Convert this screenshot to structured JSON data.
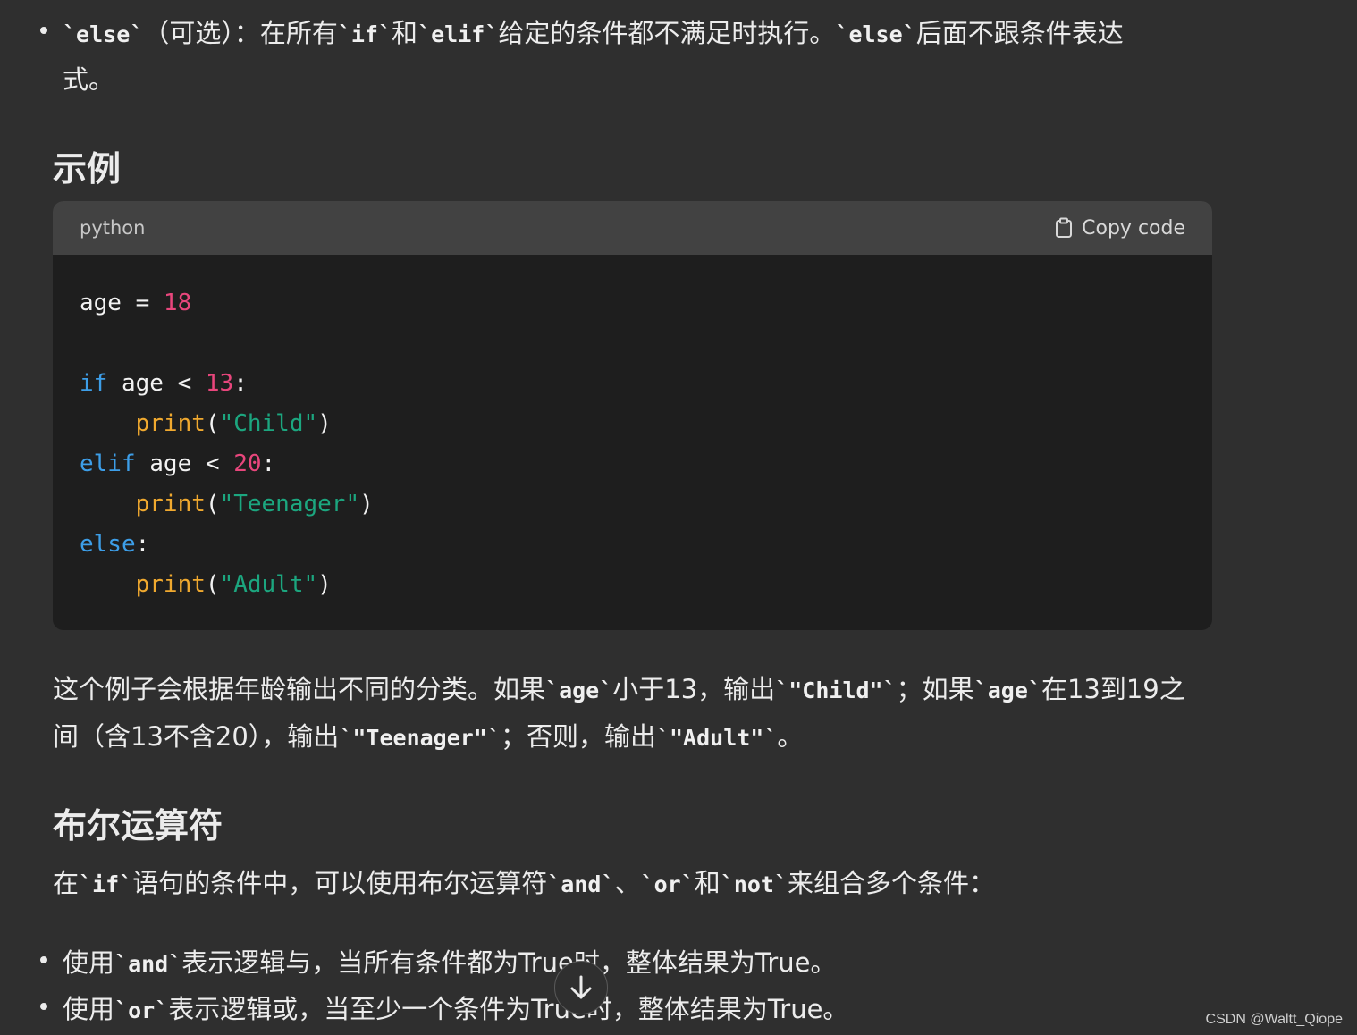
{
  "top_bullet": {
    "code1": "`else`",
    "text1": "（可选）：在所有",
    "code2": "`if`",
    "text2": "和",
    "code3": "`elif`",
    "text3": "给定的条件都不满足时执行。",
    "code4": "`else`",
    "text4": "后面不跟条件表达",
    "text5": "式。"
  },
  "example_heading": "示例",
  "code_block": {
    "language": "python",
    "copy_label": "Copy code",
    "lines": {
      "l1_a": "age = ",
      "l1_b": "18",
      "l3_a": "if",
      "l3_b": " age < ",
      "l3_c": "13",
      "l3_d": ":",
      "l4_a": "    ",
      "l4_b": "print",
      "l4_c": "(",
      "l4_d": "\"Child\"",
      "l4_e": ")",
      "l5_a": "elif",
      "l5_b": " age < ",
      "l5_c": "20",
      "l5_d": ":",
      "l6_a": "    ",
      "l6_b": "print",
      "l6_c": "(",
      "l6_d": "\"Teenager\"",
      "l6_e": ")",
      "l7_a": "else",
      "l7_b": ":",
      "l8_a": "    ",
      "l8_b": "print",
      "l8_c": "(",
      "l8_d": "\"Adult\"",
      "l8_e": ")"
    }
  },
  "explanation": {
    "t1": "这个例子会根据年龄输出不同的分类。如果",
    "c1": "`age`",
    "t2": "小于13，输出",
    "c2": "`\"Child\"`",
    "t3": "；如果",
    "c3": "`age`",
    "t4": "在13到19之",
    "t5": "间（含13不含20），输出",
    "c4": "`\"Teenager\"`",
    "t6": "；否则，输出",
    "c5": "`\"Adult\"`",
    "t7": "。"
  },
  "bool_heading": "布尔运算符",
  "bool_intro": {
    "t1": "在",
    "c1": "`if`",
    "t2": "语句的条件中，可以使用布尔运算符",
    "c2": "`and`",
    "t3": "、",
    "c3": "`or`",
    "t4": "和",
    "c4": "`not`",
    "t5": "来组合多个条件："
  },
  "bullets": [
    {
      "t1": "使用",
      "c1": "`and`",
      "t2": "表示逻辑与，当所有条件都为True时，整体结果为True。"
    },
    {
      "t1": "使用",
      "c1": "`or`",
      "t2": "表示逻辑或，当至少一个条件为True时，整体结果为True。"
    }
  ],
  "scroll_icon": "arrow-down-icon",
  "watermark": "CSDN @Waltt_Qiope"
}
